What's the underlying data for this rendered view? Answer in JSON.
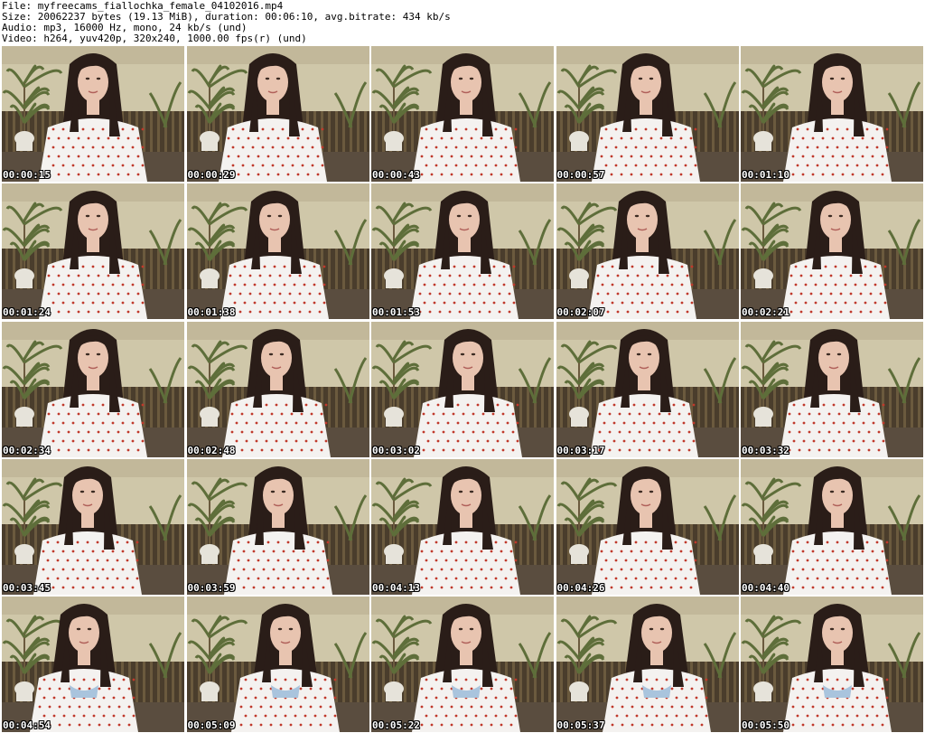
{
  "header": {
    "file": "File: myfreecams_fiallochka_female_04102016.mp4",
    "size": "Size: 20062237 bytes (19.13 MiB), duration: 00:06:10, avg.bitrate: 434 kb/s",
    "audio": "Audio: mp3, 16000 Hz, mono, 24 kb/s (und)",
    "video": "Video: h264, yuv420p, 320x240, 1000.00 fps(r) (und)"
  },
  "thumbnails": [
    {
      "timestamp": "00:00:15"
    },
    {
      "timestamp": "00:00:29"
    },
    {
      "timestamp": "00:00:43"
    },
    {
      "timestamp": "00:00:57"
    },
    {
      "timestamp": "00:01:10"
    },
    {
      "timestamp": "00:01:24"
    },
    {
      "timestamp": "00:01:38"
    },
    {
      "timestamp": "00:01:53"
    },
    {
      "timestamp": "00:02:07"
    },
    {
      "timestamp": "00:02:21"
    },
    {
      "timestamp": "00:02:34"
    },
    {
      "timestamp": "00:02:48"
    },
    {
      "timestamp": "00:03:02"
    },
    {
      "timestamp": "00:03:17"
    },
    {
      "timestamp": "00:03:32"
    },
    {
      "timestamp": "00:03:45"
    },
    {
      "timestamp": "00:03:59"
    },
    {
      "timestamp": "00:04:13"
    },
    {
      "timestamp": "00:04:26"
    },
    {
      "timestamp": "00:04:40"
    },
    {
      "timestamp": "00:04:54"
    },
    {
      "timestamp": "00:05:09"
    },
    {
      "timestamp": "00:05:22"
    },
    {
      "timestamp": "00:05:37"
    },
    {
      "timestamp": "00:05:50"
    }
  ],
  "colors": {
    "wall": "#cfc7a9",
    "wall_shadow": "#a89f7f",
    "wainscot": "#4a3d2c",
    "wainscot_stripe": "#6b5a3e",
    "floor": "#5a4d3f",
    "plant_leaf": "#5e6e3a",
    "pot": "#e6e3da",
    "hair": "#2a1d18",
    "skin": "#e8c4b0",
    "shirt": "#f4f2f0",
    "shirt_dot": "#c0392b",
    "bra": "#a9c4dd",
    "timestamp_text": "#ffffff"
  }
}
